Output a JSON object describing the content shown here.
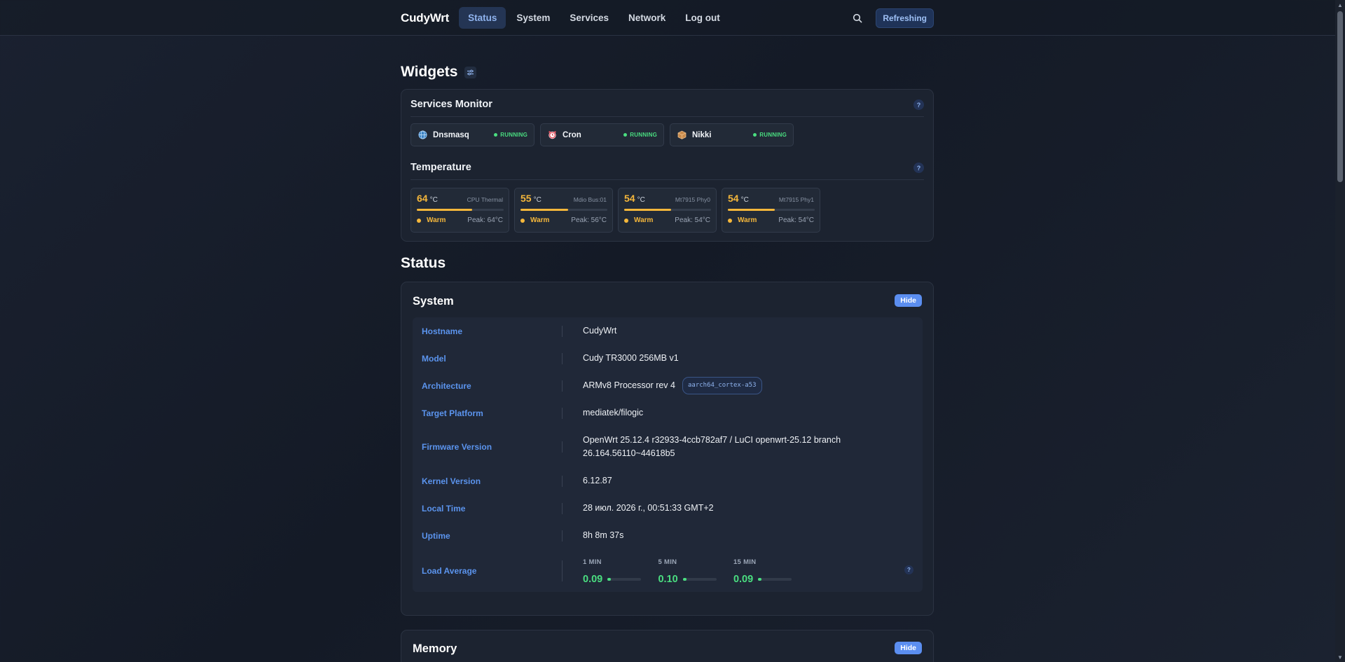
{
  "topbar": {
    "brand": "CudyWrt",
    "nav": [
      "Status",
      "System",
      "Services",
      "Network",
      "Log out"
    ],
    "active_index": 0,
    "refresh_label": "Refreshing"
  },
  "widgets": {
    "title": "Widgets",
    "services_monitor": {
      "title": "Services Monitor",
      "help": "?",
      "items": [
        {
          "name": "Dnsmasq",
          "status": "RUNNING",
          "icon": "globe-icon"
        },
        {
          "name": "Cron",
          "status": "RUNNING",
          "icon": "alarm-clock-icon"
        },
        {
          "name": "Nikki",
          "status": "RUNNING",
          "icon": "package-icon"
        }
      ]
    },
    "temperature": {
      "title": "Temperature",
      "help": "?",
      "unit": "°C",
      "sensors": [
        {
          "value": "64",
          "label": "CPU Thermal",
          "state": "Warm",
          "peak": "Peak: 64°C",
          "level": 0.64
        },
        {
          "value": "55",
          "label": "Mdio Bus:01",
          "state": "Warm",
          "peak": "Peak: 56°C",
          "level": 0.55
        },
        {
          "value": "54",
          "label": "Mt7915 Phy0",
          "state": "Warm",
          "peak": "Peak: 54°C",
          "level": 0.54
        },
        {
          "value": "54",
          "label": "Mt7915 Phy1",
          "state": "Warm",
          "peak": "Peak: 54°C",
          "level": 0.54
        }
      ]
    }
  },
  "status": {
    "title": "Status",
    "system": {
      "title": "System",
      "hide_label": "Hide",
      "rows": {
        "hostname": {
          "key": "Hostname",
          "value": "CudyWrt"
        },
        "model": {
          "key": "Model",
          "value": "Cudy TR3000 256MB v1"
        },
        "architecture": {
          "key": "Architecture",
          "value": "ARMv8 Processor rev 4",
          "tag": "aarch64_cortex-a53"
        },
        "target": {
          "key": "Target Platform",
          "value": "mediatek/filogic"
        },
        "firmware": {
          "key": "Firmware Version",
          "value_line1": "OpenWrt 25.12.4 r32933-4ccb782af7 / LuCI openwrt-25.12 branch",
          "value_line2": "26.164.56110~44618b5"
        },
        "kernel": {
          "key": "Kernel Version",
          "value": "6.12.87"
        },
        "local_time": {
          "key": "Local Time",
          "value": "28 июл. 2026 г., 00:51:33 GMT+2"
        },
        "uptime": {
          "key": "Uptime",
          "value": "8h 8m 37s"
        },
        "load_average": {
          "key": "Load Average",
          "help": "?",
          "items": [
            {
              "label": "1 MIN",
              "value": "0.09",
              "level": 0.09
            },
            {
              "label": "5 MIN",
              "value": "0.10",
              "level": 0.1
            },
            {
              "label": "15 MIN",
              "value": "0.09",
              "level": 0.09
            }
          ]
        }
      }
    },
    "memory": {
      "title": "Memory",
      "hide_label": "Hide"
    }
  }
}
